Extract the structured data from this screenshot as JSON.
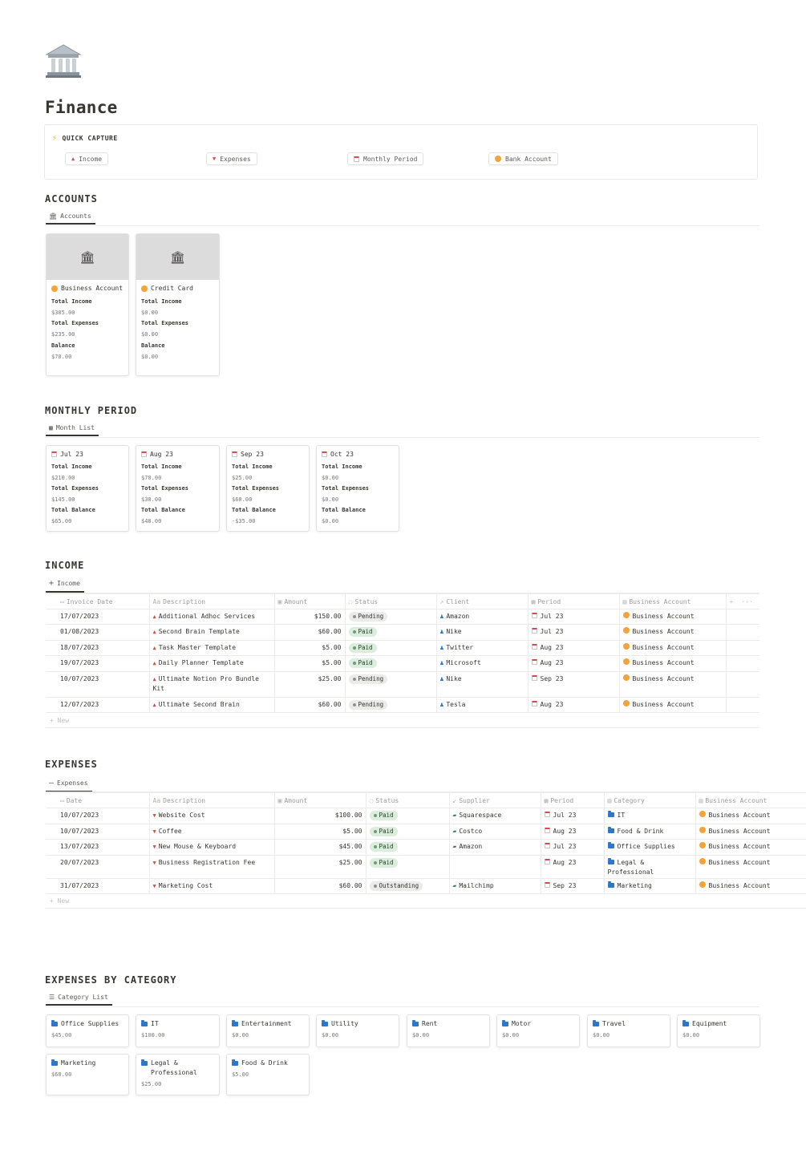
{
  "page": {
    "title": "Finance",
    "icon": "bank-icon"
  },
  "quick_capture": {
    "title": "QUICK CAPTURE",
    "buttons": [
      {
        "label": "Income",
        "icon": "triangle-up-icon"
      },
      {
        "label": "Expenses",
        "icon": "triangle-down-icon"
      },
      {
        "label": "Monthly Period",
        "icon": "calendar-icon"
      },
      {
        "label": "Bank Account",
        "icon": "orange-circle-icon"
      }
    ]
  },
  "accounts": {
    "heading": "ACCOUNTS",
    "view": "Accounts",
    "cards": [
      {
        "name": "Business Account",
        "props": [
          {
            "label": "Total Income",
            "value": "$305.00"
          },
          {
            "label": "Total Expenses",
            "value": "$235.00"
          },
          {
            "label": "Balance",
            "value": "$70.00"
          }
        ]
      },
      {
        "name": "Credit Card",
        "props": [
          {
            "label": "Total Income",
            "value": "$0.00"
          },
          {
            "label": "Total Expenses",
            "value": "$0.00"
          },
          {
            "label": "Balance",
            "value": "$0.00"
          }
        ]
      }
    ]
  },
  "monthly": {
    "heading": "MONTHLY PERIOD",
    "view": "Month List",
    "cards": [
      {
        "name": "Jul 23",
        "props": [
          {
            "label": "Total Income",
            "value": "$210.00"
          },
          {
            "label": "Total Expenses",
            "value": "$145.00"
          },
          {
            "label": "Total Balance",
            "value": "$65.00"
          }
        ]
      },
      {
        "name": "Aug 23",
        "props": [
          {
            "label": "Total Income",
            "value": "$70.00"
          },
          {
            "label": "Total Expenses",
            "value": "$30.00"
          },
          {
            "label": "Total Balance",
            "value": "$40.00"
          }
        ]
      },
      {
        "name": "Sep 23",
        "props": [
          {
            "label": "Total Income",
            "value": "$25.00"
          },
          {
            "label": "Total Expenses",
            "value": "$60.00"
          },
          {
            "label": "Total Balance",
            "value": "-$35.00"
          }
        ]
      },
      {
        "name": "Oct 23",
        "props": [
          {
            "label": "Total Income",
            "value": "$0.00"
          },
          {
            "label": "Total Expenses",
            "value": "$0.00"
          },
          {
            "label": "Total Balance",
            "value": "$0.00"
          }
        ]
      }
    ]
  },
  "income": {
    "heading": "INCOME",
    "view": "Income",
    "new_label": "New",
    "add_col": "+",
    "more": "···",
    "columns": [
      {
        "label": "Invoice Date",
        "icon": "calendar-icon"
      },
      {
        "label": "Description",
        "icon": "text-icon"
      },
      {
        "label": "Amount",
        "icon": "money-icon"
      },
      {
        "label": "Status",
        "icon": "status-icon"
      },
      {
        "label": "Client",
        "icon": "relation-icon"
      },
      {
        "label": "Period",
        "icon": "calendar-icon"
      },
      {
        "label": "Business Account",
        "icon": "database-icon"
      }
    ],
    "rows": [
      {
        "date": "17/07/2023",
        "desc": "Additional Adhoc Services",
        "amount": "$150.00",
        "status": "Pending",
        "client": "Amazon",
        "period": "Jul 23",
        "account": "Business Account"
      },
      {
        "date": "01/08/2023",
        "desc": "Second Brain Template",
        "amount": "$60.00",
        "status": "Paid",
        "client": "Nike",
        "period": "Jul 23",
        "account": "Business Account"
      },
      {
        "date": "18/07/2023",
        "desc": "Task Master Template",
        "amount": "$5.00",
        "status": "Paid",
        "client": "Twitter",
        "period": "Aug 23",
        "account": "Business Account"
      },
      {
        "date": "19/07/2023",
        "desc": "Daily Planner Template",
        "amount": "$5.00",
        "status": "Paid",
        "client": "Microsoft",
        "period": "Aug 23",
        "account": "Business Account"
      },
      {
        "date": "10/07/2023",
        "desc": "Ultimate Notion Pro Bundle Kit",
        "amount": "$25.00",
        "status": "Pending",
        "client": "Nike",
        "period": "Sep 23",
        "account": "Business Account"
      },
      {
        "date": "12/07/2023",
        "desc": "Ultimate Second Brain",
        "amount": "$60.00",
        "status": "Pending",
        "client": "Tesla",
        "period": "Aug 23",
        "account": "Business Account"
      }
    ]
  },
  "expenses": {
    "heading": "EXPENSES",
    "view": "Expenses",
    "new_label": "New",
    "columns": [
      {
        "label": "Date",
        "icon": "calendar-icon"
      },
      {
        "label": "Description",
        "icon": "text-icon"
      },
      {
        "label": "Amount",
        "icon": "money-icon"
      },
      {
        "label": "Status",
        "icon": "status-icon"
      },
      {
        "label": "Supplier",
        "icon": "relation-icon"
      },
      {
        "label": "Period",
        "icon": "calendar-icon"
      },
      {
        "label": "Category",
        "icon": "database-icon"
      },
      {
        "label": "Business Account",
        "icon": "database-icon"
      }
    ],
    "rows": [
      {
        "date": "10/07/2023",
        "desc": "Website Cost",
        "amount": "$100.00",
        "status": "Paid",
        "supplier": "Squarespace",
        "period": "Jul 23",
        "category": "IT",
        "account": "Business Account"
      },
      {
        "date": "10/07/2023",
        "desc": "Coffee",
        "amount": "$5.00",
        "status": "Paid",
        "supplier": "Costco",
        "period": "Aug 23",
        "category": "Food & Drink",
        "account": "Business Account"
      },
      {
        "date": "13/07/2023",
        "desc": "New Mouse & Keyboard",
        "amount": "$45.00",
        "status": "Paid",
        "supplier": "Amazon",
        "period": "Jul 23",
        "category": "Office Supplies",
        "account": "Business Account"
      },
      {
        "date": "20/07/2023",
        "desc": "Business Registration Fee",
        "amount": "$25.00",
        "status": "Paid",
        "supplier": "",
        "period": "Aug 23",
        "category": "Legal & Professional",
        "account": "Business Account"
      },
      {
        "date": "31/07/2023",
        "desc": "Marketing Cost",
        "amount": "$60.00",
        "status": "Outstanding",
        "supplier": "Mailchimp",
        "period": "Sep 23",
        "category": "Marketing",
        "account": "Business Account"
      }
    ]
  },
  "categories": {
    "heading": "EXPENSES BY CATEGORY",
    "view": "Category List",
    "cards": [
      {
        "name": "Office Supplies",
        "value": "$45.00"
      },
      {
        "name": "IT",
        "value": "$100.00"
      },
      {
        "name": "Entertainment",
        "value": "$0.00"
      },
      {
        "name": "Utility",
        "value": "$0.00"
      },
      {
        "name": "Rent",
        "value": "$0.00"
      },
      {
        "name": "Motor",
        "value": "$0.00"
      },
      {
        "name": "Travel",
        "value": "$0.00"
      },
      {
        "name": "Equipment",
        "value": "$0.00"
      },
      {
        "name": "Marketing",
        "value": "$60.00"
      },
      {
        "name": "Legal & Professional",
        "value": "$25.00"
      },
      {
        "name": "Food & Drink",
        "value": "$5.00"
      }
    ]
  },
  "colors": {
    "accent_red": "#d44c47",
    "paid_bg": "#dbeddb",
    "pending_bg": "#ebebea",
    "orange": "#f2a33a",
    "folder_blue": "#2e75cc"
  }
}
